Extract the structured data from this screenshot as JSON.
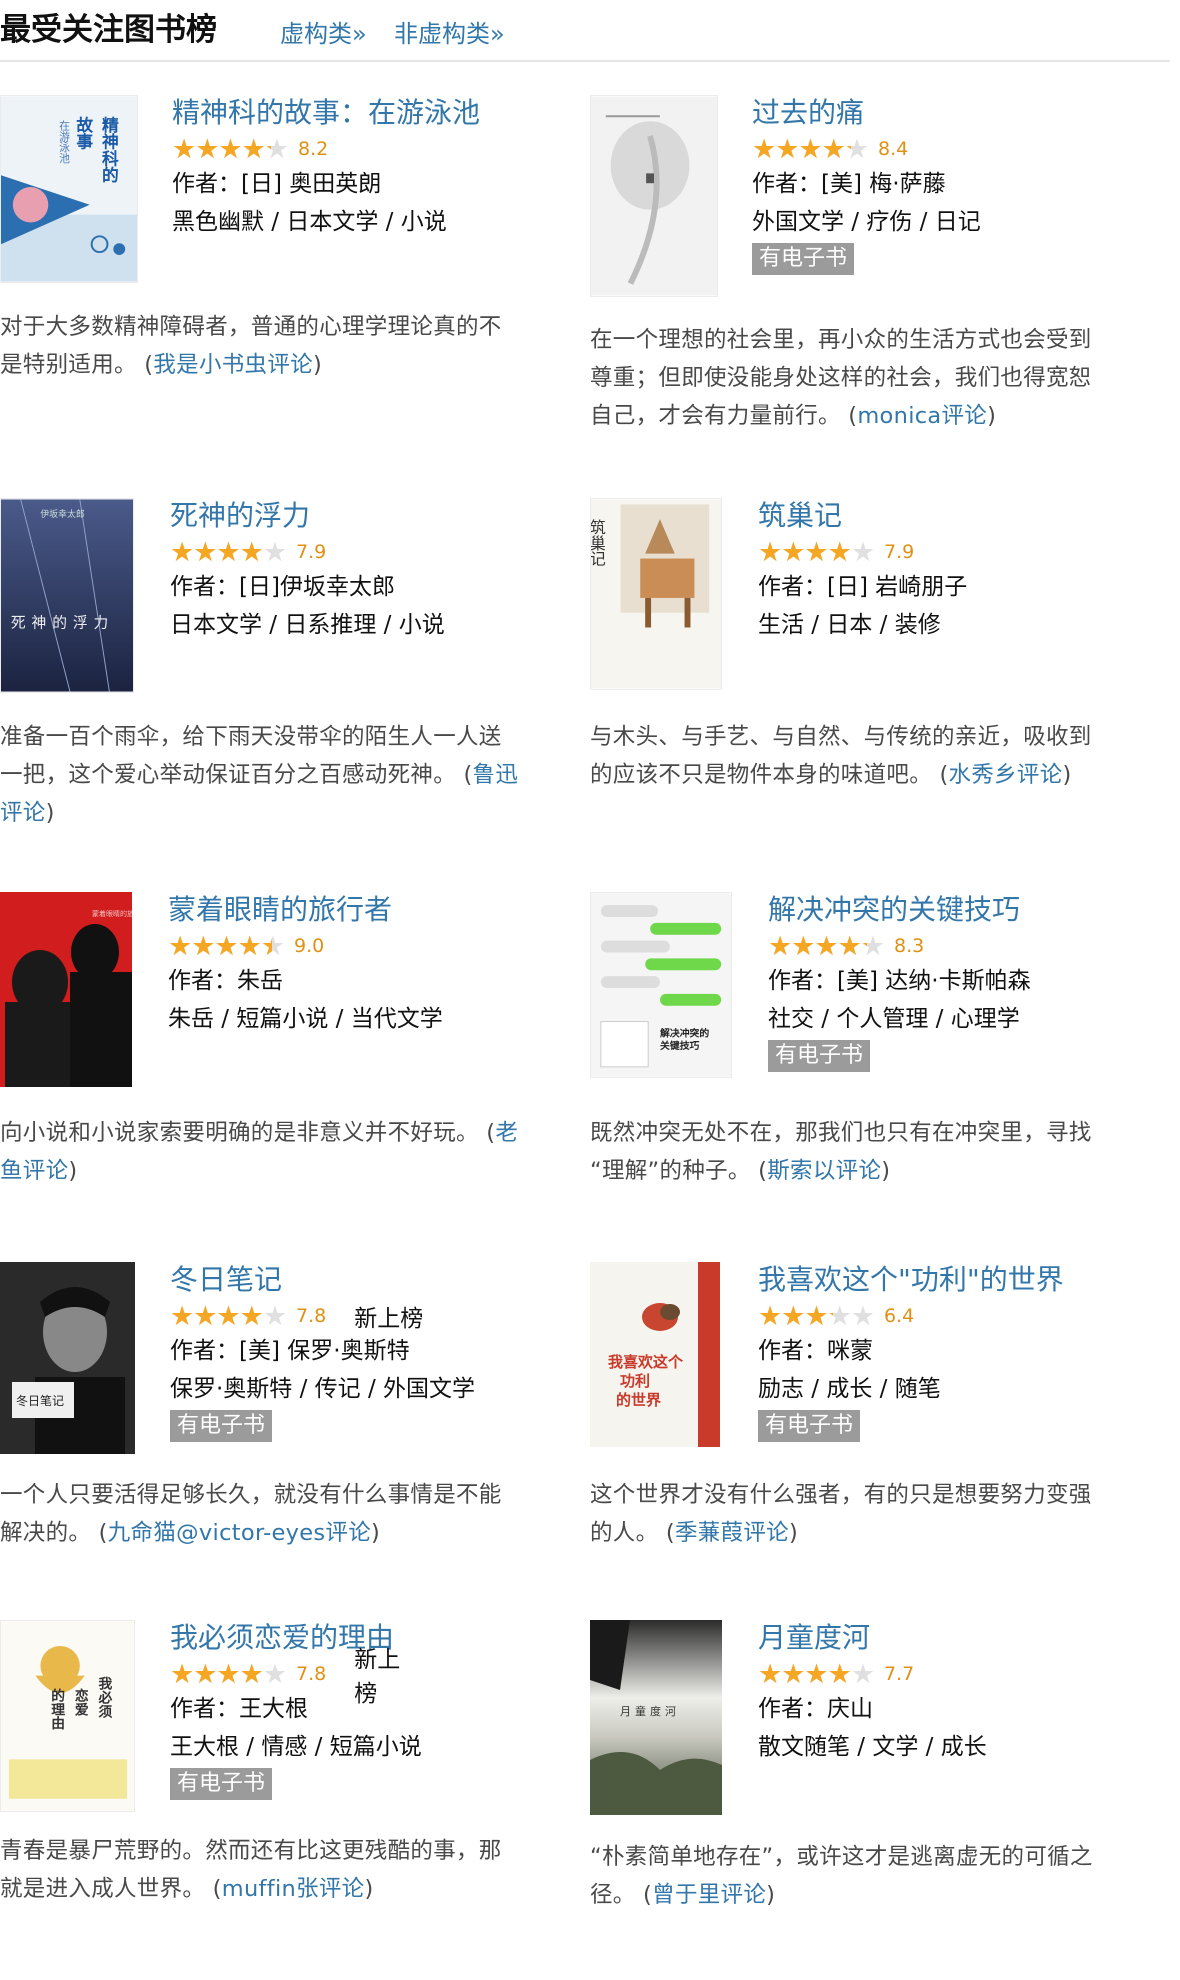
{
  "header": {
    "title": "最受关注图书榜",
    "link_fiction": "虚构类»",
    "link_nonfiction": "非虚构类»"
  },
  "colors": {
    "link": "#3377aa",
    "star": "#f5a623",
    "score": "#e09015",
    "ebook_bg": "#9b9b9b"
  },
  "books": [
    {
      "title": "精神科的故事：在游泳池",
      "rating": 8.2,
      "stars_fraction": 0.85,
      "score": "8.2",
      "new": "",
      "author": "作者：[日] 奥田英朗",
      "tags": "黑色幽默 / 日本文学 / 小说",
      "ebook": "",
      "desc_line1": "对于大多数精神障碍者，普通的心理学理论真的不",
      "desc_line2": "是特别适用。 (",
      "desc_rev": "我是小书虫评论",
      "desc_end": ")"
    },
    {
      "title": "过去的痛",
      "rating": 8.4,
      "stars_fraction": 0.85,
      "score": "8.4",
      "new": "",
      "author": "作者：[美] 梅·萨藤",
      "tags": "外国文学 / 疗伤 / 日记",
      "ebook": "有电子书",
      "desc_line1": "在一个理想的社会里，再小众的生活方式也会受到",
      "desc_line2": "尊重；但即使没能身处这样的社会，我们也得宽恕",
      "desc_line3": "自己，才会有力量前行。 (",
      "desc_rev": "monica评论",
      "desc_end": ")"
    },
    {
      "title": "死神的浮力",
      "rating": 7.9,
      "stars_fraction": 0.8,
      "score": "7.9",
      "new": "",
      "author": "作者：[日]伊坂幸太郎",
      "tags": "日本文学 / 日系推理 / 小说",
      "ebook": "",
      "desc_line1": "准备一百个雨伞，给下雨天没带伞的陌生人一人送",
      "desc_line2": "一把，这个爱心举动保证百分之百感动死神。 (",
      "desc_rev_a": "鲁迅",
      "desc_rev_b": "评论",
      "desc_end": ")"
    },
    {
      "title": "筑巢记",
      "rating": 7.9,
      "stars_fraction": 0.8,
      "score": "7.9",
      "new": "",
      "author": "作者：[日] 岩崎朋子",
      "tags": "生活 / 日本 / 装修",
      "ebook": "",
      "desc_line1": "与木头、与手艺、与自然、与传统的亲近，吸收到",
      "desc_line2": "的应该不只是物件本身的味道吧。 (",
      "desc_rev": "水秀乡评论",
      "desc_end": ")"
    },
    {
      "title": "蒙着眼睛的旅行者",
      "rating": 9.0,
      "stars_fraction": 0.9,
      "score": "9.0",
      "new": "",
      "author": "作者：朱岳",
      "tags": "朱岳 / 短篇小说 / 当代文学",
      "ebook": "",
      "desc_line1": "向小说和小说家索要明确的是非意义并不好玩。 (",
      "desc_rev_a": "老",
      "desc_rev_b": "鱼评论",
      "desc_end": ")"
    },
    {
      "title": "解决冲突的关键技巧",
      "rating": 8.3,
      "stars_fraction": 0.85,
      "score": "8.3",
      "new": "",
      "author": "作者：[美] 达纳·卡斯帕森",
      "tags": "社交 / 个人管理 / 心理学",
      "ebook": "有电子书",
      "desc_line1": "既然冲突无处不在，那我们也只有在冲突里，寻找",
      "desc_line2": "“理解”的种子。 (",
      "desc_rev": "斯索以评论",
      "desc_end": ")"
    },
    {
      "title": "冬日笔记",
      "rating": 7.8,
      "stars_fraction": 0.8,
      "score": "7.8",
      "new": "新上榜",
      "author": "作者：[美] 保罗·奥斯特",
      "tags": "保罗·奥斯特 / 传记 / 外国文学",
      "ebook": "有电子书",
      "desc_line1": "一个人只要活得足够长久，就没有什么事情是不能",
      "desc_line2": "解决的。 (",
      "desc_rev": "九命猫@victor-eyes评论",
      "desc_end": ")"
    },
    {
      "title": "我喜欢这个\"功利\"的世界",
      "rating": 6.4,
      "stars_fraction": 0.65,
      "score": "6.4",
      "new": "",
      "author": "作者：咪蒙",
      "tags": "励志 / 成长 / 随笔",
      "ebook": "有电子书",
      "desc_line1": "这个世界才没有什么强者，有的只是想要努力变强",
      "desc_line2": "的人。 (",
      "desc_rev": "季蒹葭评论",
      "desc_end": ")"
    },
    {
      "title": "我必须恋爱的理由",
      "rating": 7.8,
      "stars_fraction": 0.8,
      "score": "7.8",
      "new": "新上榜",
      "author": "作者：王大根",
      "tags": "王大根 / 情感 / 短篇小说",
      "ebook": "有电子书",
      "desc_line1": "青春是暴尸荒野的。然而还有比这更残酷的事，那",
      "desc_line2": "就是进入成人世界。 (",
      "desc_rev": "muffin张评论",
      "desc_end": ")"
    },
    {
      "title": "月童度河",
      "rating": 7.7,
      "stars_fraction": 0.8,
      "score": "7.7",
      "new": "",
      "author": "作者：庆山",
      "tags": "散文随笔 / 文学 / 成长",
      "ebook": "",
      "desc_line1": "“朴素简单地存在”，或许这才是逃离虚无的可循之",
      "desc_line2": "径。 (",
      "desc_rev": "曾于里评论",
      "desc_end": ")"
    }
  ],
  "covers": {
    "c0": {
      "line1": "精神科的",
      "line2": "故事",
      "line3": "在游泳池"
    },
    "c2": {
      "top": "伊坂幸太郎",
      "main": "死神的浮力"
    },
    "c3": {
      "main": "筑巢记"
    },
    "c4": {
      "text": "蒙着眼睛的旅行者"
    },
    "c5": {
      "line1": "解决冲突的",
      "line2": "关键技巧"
    },
    "c6": {
      "main": "冬日笔记"
    },
    "c7": {
      "line1": "我喜欢这个",
      "line2": "功利",
      "line3": "的世界"
    },
    "c8": {
      "line1": "我必须",
      "line2": "恋爱",
      "line3": "的理由"
    },
    "c9": {
      "main": "月童度河"
    }
  }
}
